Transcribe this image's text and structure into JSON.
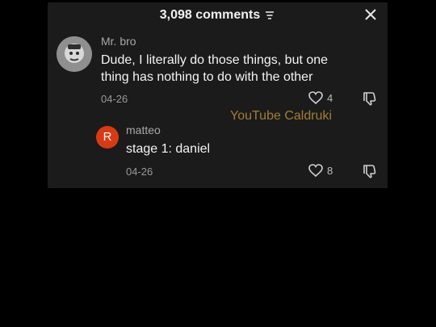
{
  "header": {
    "comment_count": "3,098 comments"
  },
  "comments": [
    {
      "author": "Mr. bro",
      "text_line_1": "Dude, I literally do those things, but one",
      "text_line_2": "thing has nothing to do with the other",
      "date": "04-26",
      "likes": "4"
    },
    {
      "author": "matteo",
      "avatar_letter": "R",
      "text": "stage 1: daniel",
      "date": "04-26",
      "likes": "8"
    }
  ],
  "watermark": "YouTube Caldruki",
  "colors": {
    "panel": "#1b1b1b",
    "avatar_reply": "#d83b14",
    "watermark": "#c79a34"
  }
}
